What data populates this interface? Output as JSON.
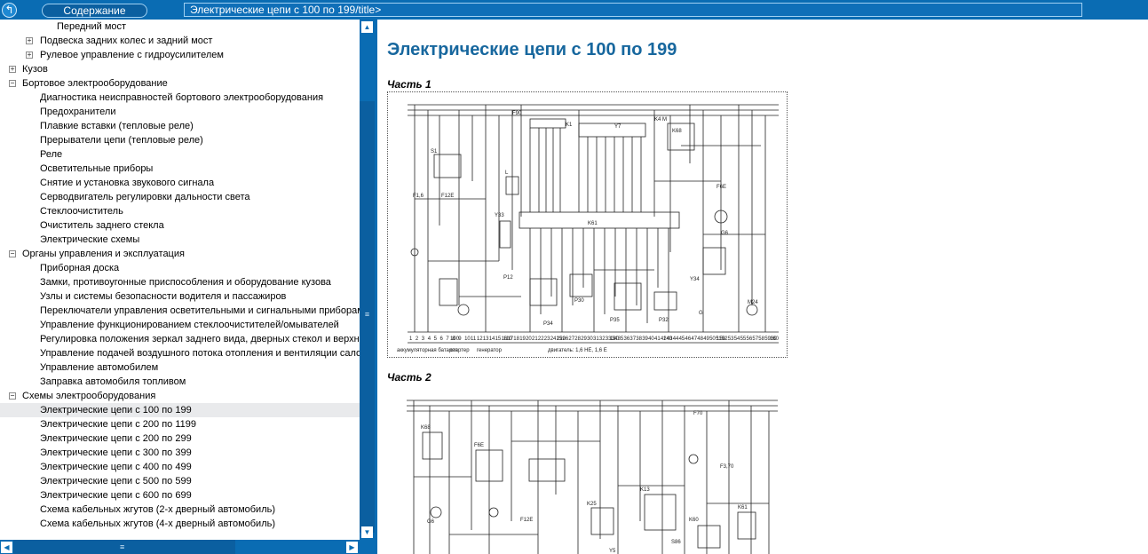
{
  "toolbar": {
    "back_icon": "↰",
    "contents_label": "Содержание",
    "title_path": "Электрические цепи с 100 по 199/title>"
  },
  "tree": {
    "items": [
      {
        "label": "Передний мост",
        "toggle": ""
      },
      {
        "label": "Подвеска задних колес и задний мост",
        "toggle": "+"
      },
      {
        "label": "Рулевое управление с гидроусилителем",
        "toggle": "+"
      },
      {
        "label": "Кузов",
        "toggle": "+"
      },
      {
        "label": "Бортовое электрооборудование",
        "toggle": "−"
      },
      {
        "label": "Диагностика неисправностей бортового электрооборудования",
        "toggle": ""
      },
      {
        "label": "Предохранители",
        "toggle": ""
      },
      {
        "label": "Плавкие вставки (тепловые реле)",
        "toggle": ""
      },
      {
        "label": "Прерыватели цепи (тепловые реле)",
        "toggle": ""
      },
      {
        "label": "Реле",
        "toggle": ""
      },
      {
        "label": "Осветительные приборы",
        "toggle": ""
      },
      {
        "label": "Снятие и установка звукового сигнала",
        "toggle": ""
      },
      {
        "label": "Серводвигатель регулировки дальности света",
        "toggle": ""
      },
      {
        "label": "Стеклоочиститель",
        "toggle": ""
      },
      {
        "label": "Очиститель заднего стекла",
        "toggle": ""
      },
      {
        "label": "Электрические схемы",
        "toggle": ""
      },
      {
        "label": "Органы управления и эксплуатация",
        "toggle": "−"
      },
      {
        "label": "Приборная доска",
        "toggle": ""
      },
      {
        "label": "Замки, противоугонные приспособления и оборудование кузова",
        "toggle": ""
      },
      {
        "label": "Узлы и системы безопасности водителя и пассажиров",
        "toggle": ""
      },
      {
        "label": "Переключатели управления осветительными и сигнальными приборами",
        "toggle": ""
      },
      {
        "label": "Управление функционированием стеклоочистителей/омывателей",
        "toggle": ""
      },
      {
        "label": "Регулировка положения зеркал заднего вида, дверных стекол и верхнего люка",
        "toggle": ""
      },
      {
        "label": "Управление подачей воздушного потока отопления и вентиляции салона",
        "toggle": ""
      },
      {
        "label": "Управление автомобилем",
        "toggle": ""
      },
      {
        "label": "Заправка автомобиля топливом",
        "toggle": ""
      },
      {
        "label": "Схемы электрооборудования",
        "toggle": "−"
      },
      {
        "label": "Электрические цепи с 100 по 199",
        "toggle": "",
        "selected": true
      },
      {
        "label": "Электрические цепи с 200 по 1199",
        "toggle": ""
      },
      {
        "label": "Электрические цепи с 200 по 299",
        "toggle": ""
      },
      {
        "label": "Электрические цепи с 300 по 399",
        "toggle": ""
      },
      {
        "label": "Электрические цепи с 400 по 499",
        "toggle": ""
      },
      {
        "label": "Электрические цепи с 500 по 599",
        "toggle": ""
      },
      {
        "label": "Электрические цепи с 600 по 699",
        "toggle": ""
      },
      {
        "label": "Схема кабельных жгутов (2-х дверный автомобиль)",
        "toggle": ""
      },
      {
        "label": "Схема кабельных жгутов (4-х дверный автомобиль)",
        "toggle": ""
      }
    ]
  },
  "scroll": {
    "up": "▲",
    "down": "▼",
    "left": "◀",
    "right": "▶",
    "grip_v": "≡",
    "grip_h": "≡"
  },
  "content": {
    "title": "Электрические цепи с 100 по 199",
    "part1_label": "Часть 1",
    "part2_label": "Часть 2",
    "diagram1": {
      "top_labels": [
        "F90",
        "K1",
        "K4 M",
        "Y7",
        "K68",
        "F1,6",
        "F12E",
        "F6E",
        "S1",
        "L",
        "Y33",
        "G"
      ],
      "mid_labels": [
        "K61",
        "P12",
        "P34",
        "P30",
        "P35",
        "P32",
        "Y34",
        "G6",
        "M24"
      ],
      "bottom_numbers": [
        "1",
        "2",
        "3",
        "4",
        "5",
        "6",
        "7",
        "8",
        "9",
        "10",
        "11",
        "12",
        "13",
        "14",
        "15",
        "16",
        "17",
        "18",
        "19",
        "20",
        "21",
        "22",
        "23",
        "24",
        "25",
        "26",
        "27",
        "28",
        "29",
        "30",
        "31",
        "32",
        "33",
        "34",
        "35",
        "36",
        "37",
        "38",
        "39",
        "40",
        "41",
        "42",
        "43",
        "44",
        "45",
        "46",
        "47",
        "48",
        "49",
        "50",
        "51",
        "52",
        "53",
        "54",
        "55",
        "56",
        "57",
        "58",
        "59",
        "60"
      ],
      "markers": [
        "100",
        "110",
        "120",
        "130",
        "140",
        "150",
        "160"
      ],
      "footer": [
        "аккумуляторная батарея",
        "стартер",
        "генератор",
        "двигатель: 1,6 НЕ, 1,6 Е"
      ]
    },
    "diagram2": {
      "labels": [
        "K68",
        "F6E",
        "G6",
        "F12E",
        "K25",
        "K13",
        "K61",
        "F70",
        "F3,70",
        "Y5",
        "S86",
        "K60"
      ]
    }
  },
  "colors": {
    "bar": "#0a6cb3",
    "title": "#17679e",
    "selected_row": "#e9eaec"
  }
}
